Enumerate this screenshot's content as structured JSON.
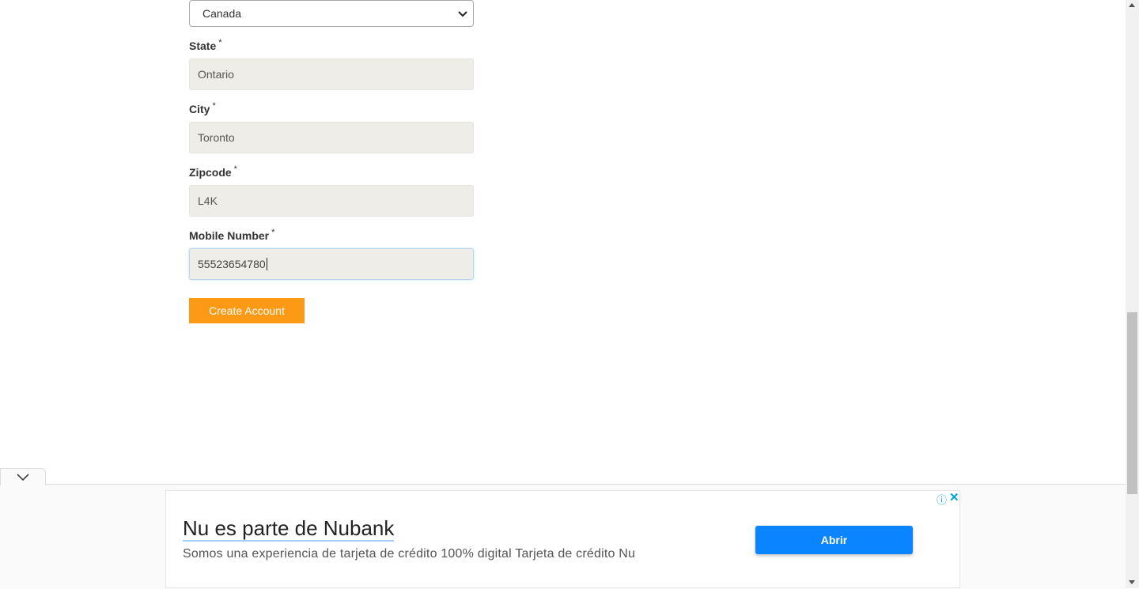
{
  "form": {
    "country_value": "Canada",
    "state_label": "State",
    "state_value": "Ontario",
    "city_label": "City",
    "city_value": "Toronto",
    "zipcode_label": "Zipcode",
    "zipcode_value": "L4K",
    "mobile_label": "Mobile Number",
    "mobile_value": "55523654780",
    "required_mark": "*",
    "submit_label": "Create Account"
  },
  "ad": {
    "title": "Nu es parte de Nubank",
    "description": "Somos una experiencia de tarjeta de crédito 100% digital Tarjeta de crédito Nu",
    "cta": "Abrir",
    "info_icon": "ⓘ",
    "close_icon": "✕"
  },
  "colors": {
    "submit_bg": "#fd9a15",
    "ad_cta_bg": "#0a84ff",
    "field_bg": "#eeede7"
  }
}
